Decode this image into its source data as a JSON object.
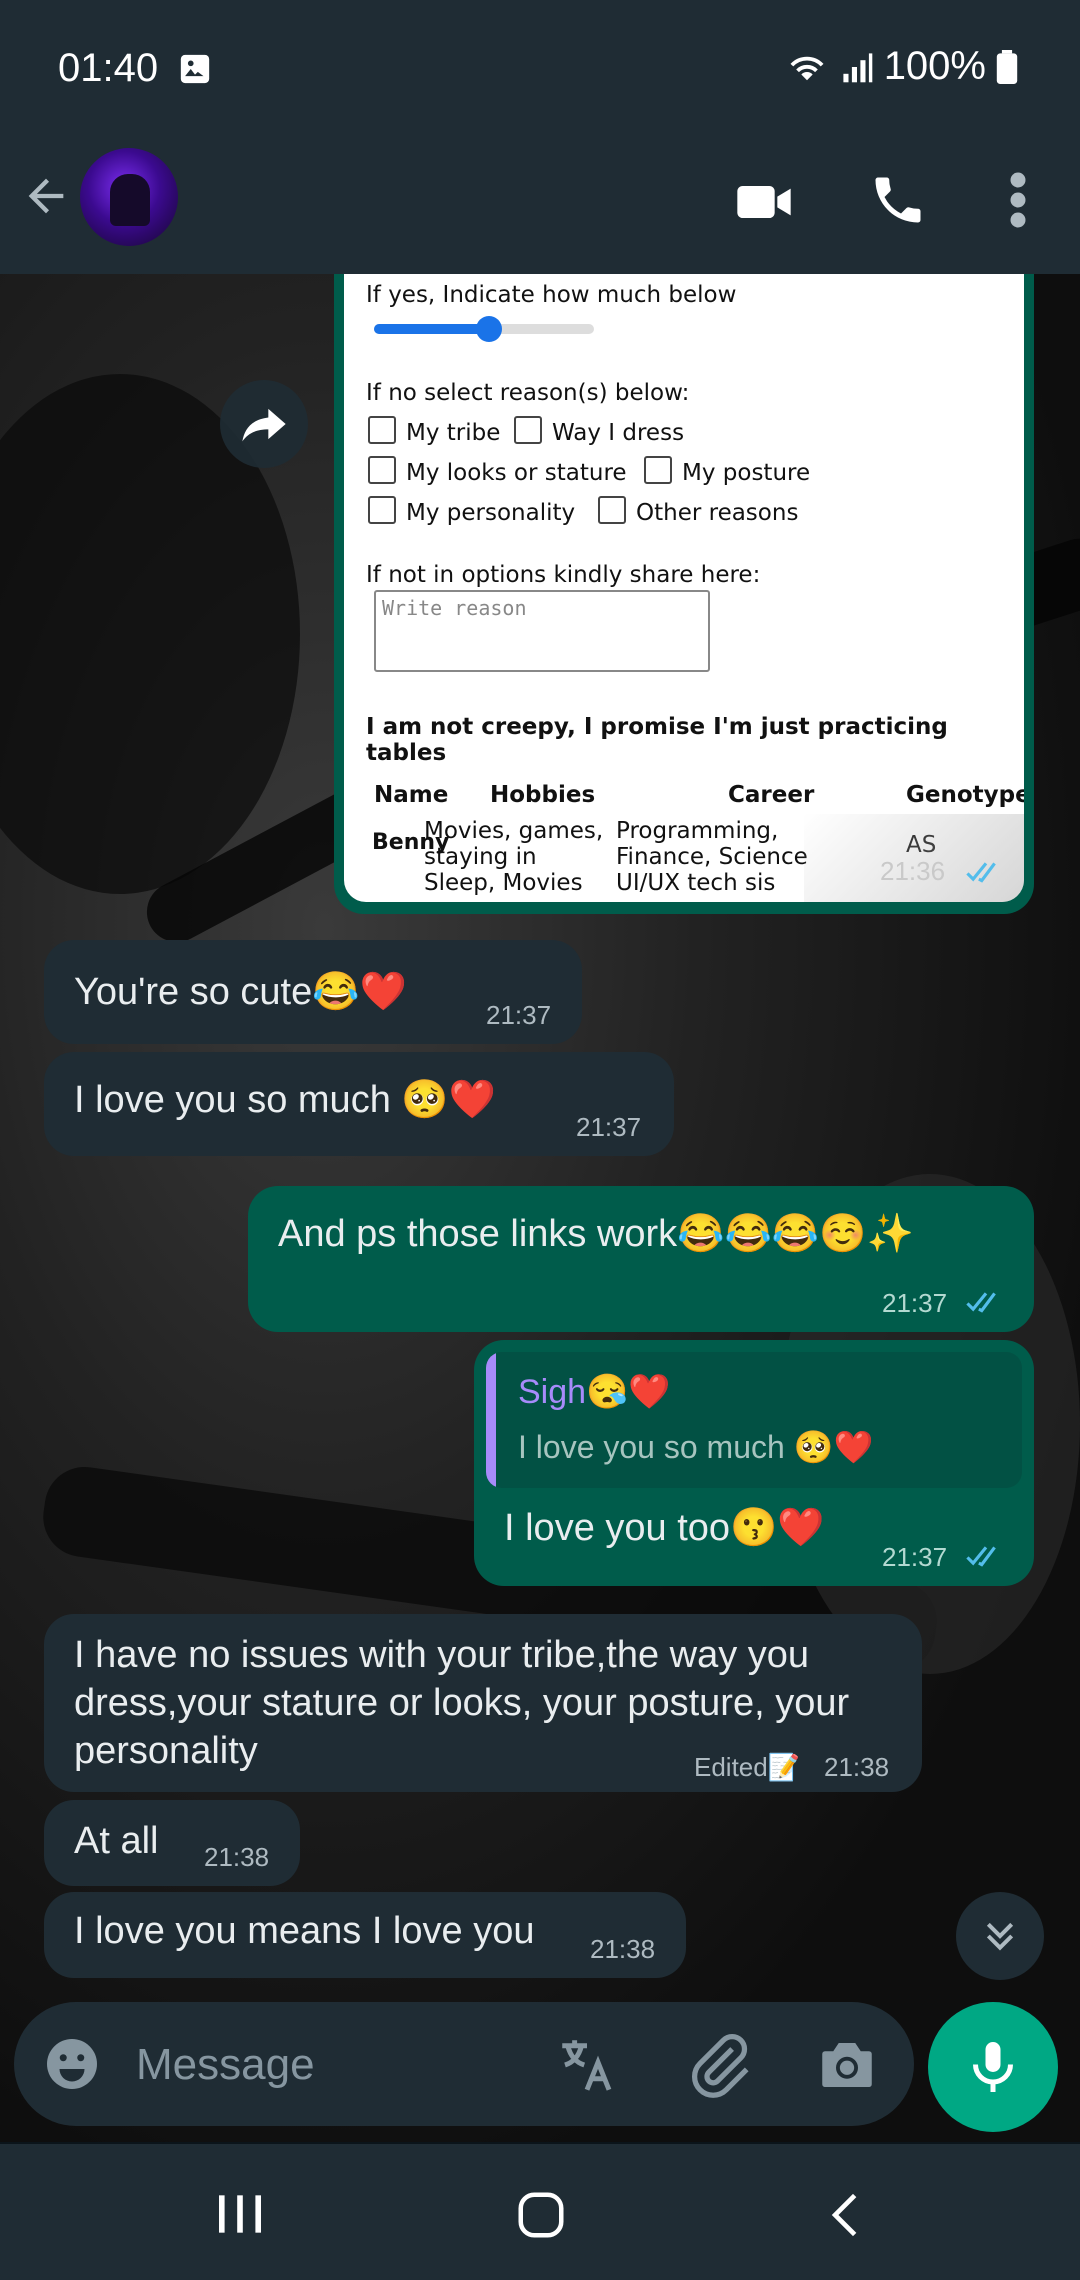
{
  "status_bar": {
    "time": "01:40",
    "battery": "100%"
  },
  "header": {
    "contact_avatar": "contact-avatar"
  },
  "image_message": {
    "question_slider": "If yes, Indicate how much below",
    "slider_fraction": 0.45,
    "question_reasons": "If no select reason(s) below:",
    "checkboxes": [
      "My tribe",
      "Way I dress",
      "My looks or stature",
      "My posture",
      "My personality",
      "Other reasons"
    ],
    "question_other": "If not in options kindly share here:",
    "textarea_placeholder": "Write reason",
    "table_title": "I am not creepy, I promise I'm just practicing tables",
    "table_headers": [
      "Name",
      "Hobbies",
      "Career",
      "Genotype"
    ],
    "row1": {
      "name": "Benny",
      "hobbies_1": "Movies, games,",
      "hobbies_2": "staying in",
      "career_1": "Programming,",
      "career_2": "Finance, Science",
      "genotype": "AS"
    },
    "row2": {
      "hobbies": "Sleep, Movies",
      "career": "UI/UX tech sis"
    },
    "time": "21:36"
  },
  "messages": [
    {
      "text": "You're so cute😂❤️",
      "time": "21:37"
    },
    {
      "text": "I love you so much 🥺❤️",
      "time": "21:37"
    },
    {
      "text": "And ps those links work😂😂😂☺️✨",
      "time": "21:37"
    },
    {
      "quote_author": "Sigh😪❤️",
      "quote_text": "I love you so much 🥺❤️",
      "text": "I love you too😗❤️",
      "time": "21:37"
    },
    {
      "text_1": "I have no issues with your tribe,the way you",
      "text_2": "dress,your stature or looks, your posture, your",
      "text_3": "personality",
      "edited": "Edited📝",
      "time": "21:38"
    },
    {
      "text": "At all",
      "time": "21:38"
    },
    {
      "text": "I love you means I love you",
      "time": "21:38"
    }
  ],
  "input": {
    "placeholder": "Message"
  }
}
